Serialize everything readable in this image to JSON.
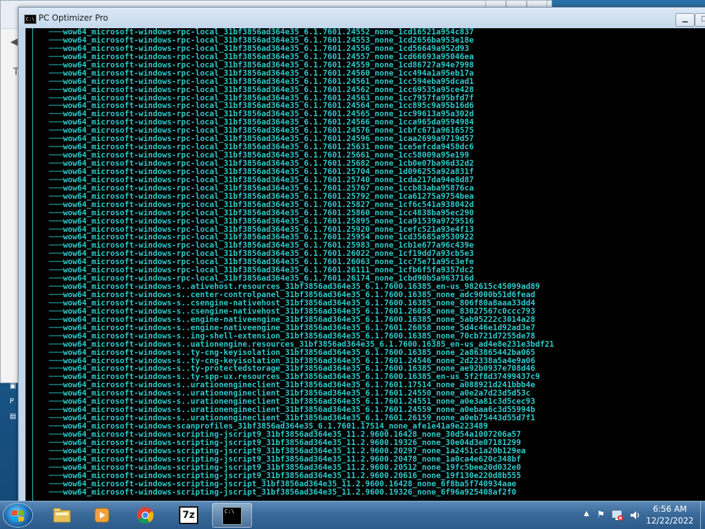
{
  "window": {
    "title": "PC Optimizer Pro",
    "icon_label": "C:\\"
  },
  "console_lines": [
    "wow64_microsoft-windows-rpc-local_31bf3856ad364e35_6.1.7601.24552_none_1cd16521a954c837",
    "wow64_microsoft-windows-rpc-local_31bf3856ad364e35_6.1.7601.24553_none_1cd2656ba953e18e",
    "wow64_microsoft-windows-rpc-local_31bf3856ad364e35_6.1.7601.24556_none_1cd56649a952d93",
    "wow64_microsoft-windows-rpc-local_31bf3856ad364e35_6.1.7601.24557_none_1cd66693a95046ea",
    "wow64_microsoft-windows-rpc-local_31bf3856ad364e35_6.1.7601.24559_none_1cd86727a94e7998",
    "wow64_microsoft-windows-rpc-local_31bf3856ad364e35_6.1.7601.24560_none_1cc494a1a95eb17a",
    "wow64_microsoft-windows-rpc-local_31bf3856ad364e35_6.1.7601.24561_none_1cc594eba95dcad1",
    "wow64_microsoft-windows-rpc-local_31bf3856ad364e35_6.1.7601.24562_none_1cc69535a95ce428",
    "wow64_microsoft-windows-rpc-local_31bf3856ad364e35_6.1.7601.24563_none_1cc7957fa95bfd7f",
    "wow64_microsoft-windows-rpc-local_31bf3856ad364e35_6.1.7601.24564_none_1cc895c9a95b16d6",
    "wow64_microsoft-windows-rpc-local_31bf3856ad364e35_6.1.7601.24565_none_1cc99613a95a302d",
    "wow64_microsoft-windows-rpc-local_31bf3856ad364e35_6.1.7601.24566_none_1cca965da9594984",
    "wow64_microsoft-windows-rpc-local_31bf3856ad364e35_6.1.7601.24576_none_1cbfc671a9616575",
    "wow64_microsoft-windows-rpc-local_31bf3856ad364e35_6.1.7601.24596_none_1caa2699a9719d57",
    "wow64_microsoft-windows-rpc-local_31bf3856ad364e35_6.1.7601.25631_none_1ce5efcda9458dc6",
    "wow64_microsoft-windows-rpc-local_31bf3856ad364e35_6.1.7601.25661_none_1cc58009a95e199",
    "wow64_microsoft-windows-rpc-local_31bf3856ad364e35_6.1.7601.25682_none_1cb0e07ba96d32d2",
    "wow64_microsoft-windows-rpc-local_31bf3856ad364e35_6.1.7601.25704_none_1d096255a92a831f",
    "wow64_microsoft-windows-rpc-local_31bf3856ad364e35_6.1.7601.25740_none_1cda217da94e8d87",
    "wow64_microsoft-windows-rpc-local_31bf3856ad364e35_6.1.7601.25767_none_1ccb83aba95876ca",
    "wow64_microsoft-windows-rpc-local_31bf3856ad364e35_6.1.7601.25792_none_1ca61275a9754bea",
    "wow64_microsoft-windows-rpc-local_31bf3856ad364e35_6.1.7601.25827_none_1cf6c541a938042d",
    "wow64_microsoft-windows-rpc-local_31bf3856ad364e35_6.1.7601.25860_none_1cc4838ba95ec290",
    "wow64_microsoft-windows-rpc-local_31bf3856ad364e35_6.1.7601.25895_none_1ca91539a9729516",
    "wow64_microsoft-windows-rpc-local_31bf3856ad364e35_6.1.7601.25920_none_1cefc521a93e4f13",
    "wow64_microsoft-windows-rpc-local_31bf3856ad364e35_6.1.7601.25954_none_1cd35685a9530922",
    "wow64_microsoft-windows-rpc-local_31bf3856ad364e35_6.1.7601.25983_none_1cb1e677a96c439e",
    "wow64_microsoft-windows-rpc-local_31bf3856ad364e35_6.1.7601.26022_none_1cf19dd7a93cb5e3",
    "wow64_microsoft-windows-rpc-local_31bf3856ad364e35_6.1.7601.26063_none_1cc75e71a95c3efe",
    "wow64_microsoft-windows-rpc-local_31bf3856ad364e35_6.1.7601.26111_none_1cfb6f5fa9357dc2",
    "wow64_microsoft-windows-rpc-local_31bf3856ad364e35_6.1.7601.26174_none_1cbd90b5a963716d",
    "wow64_microsoft-windows-s..ativehost.resources_31bf3856ad364e35_6.1.7600.16385_en-us_982615c45099ad89",
    "wow64_microsoft-windows-s..center-controlpanel_31bf3856ad364e35_6.1.7600.16385_none_adc9000b51d6fead",
    "wow64_microsoft-windows-s..csengine-nativehost_31bf3856ad364e35_6.1.7600.16385_none_806f80a8aaa33dd4",
    "wow64_microsoft-windows-s..csengine-nativehost_31bf3856ad364e35_6.1.7601.26058_none_83027567c0ccc793",
    "wow64_microsoft-windows-s..engine-nativeengine_31bf3856ad364e35_6.1.7600.16385_none_5ab95222c3014a28",
    "wow64_microsoft-windows-s..engine-nativeengine_31bf3856ad364e35_6.1.7601.26058_none_5d4c46e1d92ad3e7",
    "wow64_microsoft-windows-s..ing-shell-extension_31bf3856ad364e35_6.1.7600.16385_none_70cb721d7255de78",
    "wow64_microsoft-windows-s..uationengine.resources_31bf3856ad364e35_6.1.7600.16385_en-us_ad4e8e231e3bdf21",
    "wow64_microsoft-windows-s..ty-cng-keyisolation_31bf3856ad364e35_6.1.7600.16385_none_2a863865442ba065",
    "wow64_microsoft-windows-s..ty-cng-keyisolation_31bf3856ad364e35_6.1.7601.24546_none_2d22338a5a4e9a06",
    "wow64_microsoft-windows-s..ty-protectedstorage_31bf3856ad364e35_6.1.7600.16385_none_ae92b0937e708d46",
    "wow64_microsoft-windows-s..ty-spp-ux.resources_31bf3856ad364e35_6.1.7600.16385_en-us_5f2f8d37499437c9",
    "wow64_microsoft-windows-s..urationengineclient_31bf3856ad364e35_6.1.7601.17514_none_a088921d241bbb4e",
    "wow64_microsoft-windows-s..urationengineclient_31bf3856ad364e35_6.1.7601.24550_none_a0e2a7d23d5d53c",
    "wow64_microsoft-windows-s..urationengineclient_31bf3856ad364e35_6.1.7601.24551_none_a0e3a81c3d5cec93",
    "wow64_microsoft-windows-s..urationengineclient_31bf3856ad364e35_6.1.7601.24559_none_a0ebaa6c3d55994b",
    "wow64_microsoft-windows-s..urationengineclient_31bf3856ad364e35_6.1.7601.26159_none_a0eb75443d55d7f1",
    "wow64_microsoft-windows-scanprofiles_31bf3856ad364e35_6.1.7601.17514_none_afe1e41a9e223489",
    "wow64_microsoft-windows-scripting-jscript9_31bf3856ad364e35_11.2.9600.16428_none_30d54a1007206a57",
    "wow64_microsoft-windows-scripting-jscript9_31bf3856ad364e35_11.2.9600.19326_none_30e04d3e07181299",
    "wow64_microsoft-windows-scripting-jscript9_31bf3856ad364e35_11.2.9600.20297_none_1a2451c1a20b129ea",
    "wow64_microsoft-windows-scripting-jscript9_31bf3856ad364e35_11.2.9600.20478_none_1a0ca4e620c348bf",
    "wow64_microsoft-windows-scripting-jscript9_31bf3856ad364e35_11.2.9600.20512_none_19fc5bee20d032e0",
    "wow64_microsoft-windows-scripting-jscript9_31bf3856ad364e35_11.2.9600.20616_none_19f130e220d8b555",
    "wow64_microsoft-windows-scripting-jscript_31bf3856ad364e35_11.2.9600.16428_none_6f8ba5f740934aae",
    "wow64_microsoft-windows-scripting-jscript_31bf3856ad364e35_11.2.9600.19326_none_6f96a925408af2f0"
  ],
  "taskbar": {
    "apps": [
      {
        "name": "Windows Explorer",
        "icon": "folder-icon"
      },
      {
        "name": "Windows Media Player",
        "icon": "media-player-icon"
      },
      {
        "name": "Google Chrome",
        "icon": "chrome-icon"
      },
      {
        "name": "7-Zip",
        "icon": "7zip-icon",
        "label": "7z"
      },
      {
        "name": "Command Prompt",
        "icon": "cmd-icon",
        "label": "C:\\",
        "active": true
      }
    ],
    "tray": {
      "arrow": "▲",
      "time": "6:56 AM",
      "date": "12/22/2022"
    }
  },
  "colors": {
    "console_text": "#2ec9c9",
    "console_bg": "#000000",
    "taskbar": "#3a6a9a"
  }
}
